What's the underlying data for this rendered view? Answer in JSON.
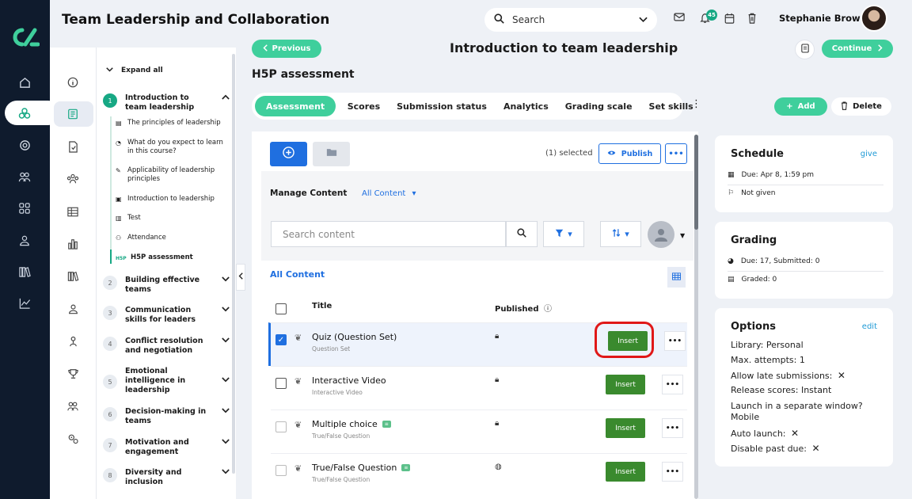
{
  "app": {
    "title": "Team Leadership and Collaboration",
    "logo": "CL"
  },
  "header": {
    "search_placeholder": "Search",
    "notification_count": "45",
    "user_name": "Stephanie Brown",
    "icons": [
      "mail-icon",
      "bell-icon",
      "calendar-icon",
      "trash-icon"
    ]
  },
  "outline": {
    "expand_all": "Expand all",
    "modules": [
      {
        "num": "1",
        "title": "Introduction to team leadership",
        "expanded": true
      },
      {
        "num": "2",
        "title": "Building effective teams"
      },
      {
        "num": "3",
        "title": "Communication skills for leaders"
      },
      {
        "num": "4",
        "title": "Conflict resolution and negotiation"
      },
      {
        "num": "5",
        "title": "Emotional intelligence in leadership"
      },
      {
        "num": "6",
        "title": "Decision-making in teams"
      },
      {
        "num": "7",
        "title": "Motivation and engagement"
      },
      {
        "num": "8",
        "title": "Diversity and inclusion"
      }
    ],
    "lessons": [
      {
        "icon": "document-icon",
        "title": "The principles of leadership"
      },
      {
        "icon": "pie-icon",
        "title": "What do you expect to learn in this course?"
      },
      {
        "icon": "pen-icon",
        "title": "Applicability of leadership principles"
      },
      {
        "icon": "video-icon",
        "title": "Introduction to leadership"
      },
      {
        "icon": "test-icon",
        "title": "Test"
      },
      {
        "icon": "people-icon",
        "title": "Attendance"
      },
      {
        "icon": "h5p-icon",
        "prefix": "H5P",
        "title": "H5P assessment"
      }
    ]
  },
  "main": {
    "prev_label": "Previous",
    "continue_label": "Continue",
    "page_title": "Introduction to team leadership",
    "section_title": "H5P assessment",
    "tabs": [
      "Assessment",
      "Scores",
      "Submission status",
      "Analytics",
      "Grading scale",
      "Set skills"
    ],
    "add_label": "Add",
    "delete_label": "Delete"
  },
  "h5p": {
    "selected_text": "(1) selected",
    "publish_label": "Publish",
    "more_label": "•••",
    "manage_label": "Manage Content",
    "all_content_dropdown": "All Content",
    "search_placeholder": "Search content",
    "list_title": "All Content",
    "col_title": "Title",
    "col_published": "Published",
    "insert_label": "Insert",
    "rows": [
      {
        "name": "Quiz (Question Set)",
        "type": "Question Set",
        "checked": true,
        "published": "lock"
      },
      {
        "name": "Interactive Video",
        "type": "Interactive Video",
        "checked": false,
        "published": "lock"
      },
      {
        "name": "Multiple choice",
        "type": "True/False Question",
        "checked": false,
        "published": "lock",
        "tag": true
      },
      {
        "name": "True/False Question",
        "type": "True/False Question",
        "checked": false,
        "published": "globe",
        "tag": true
      }
    ]
  },
  "schedule": {
    "title": "Schedule",
    "link": "give",
    "due": "Due: Apr 8, 1:59 pm",
    "given": "Not given"
  },
  "grading": {
    "title": "Grading",
    "due": "Due: 17, Submitted: 0",
    "graded": "Graded: 0"
  },
  "options": {
    "title": "Options",
    "link": "edit",
    "library": "Library: Personal",
    "max_attempts": "Max. attempts: 1",
    "late": "Allow late submissions:",
    "release": "Release scores: Instant",
    "launch_window": "Launch in a separate window? Mobile",
    "auto_launch": "Auto launch:",
    "disable_past": "Disable past due:"
  },
  "colors": {
    "accent": "#3fcf9c",
    "blue": "#1f6fe0",
    "insert": "#3a8a2e",
    "rail": "#0f1b2d",
    "highlight": "#e01818"
  }
}
